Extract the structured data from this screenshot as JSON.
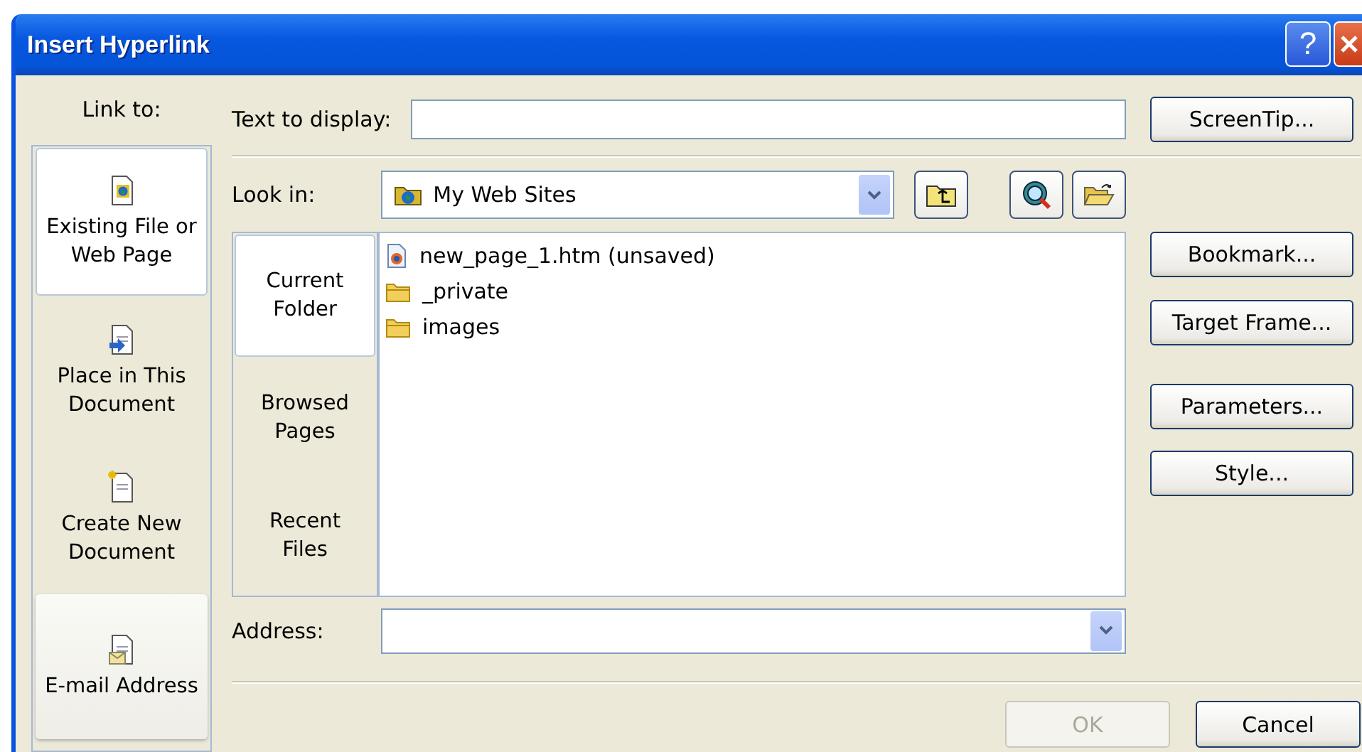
{
  "window": {
    "title": "Insert Hyperlink",
    "help_button": "?"
  },
  "link_to": {
    "label": "Link to:",
    "items": [
      {
        "label": "Existing File or Web Page",
        "kind": "globe-page",
        "selected": true,
        "highlighted": false
      },
      {
        "label": "Place in This Document",
        "kind": "arrow-page",
        "selected": false,
        "highlighted": false
      },
      {
        "label": "Create New Document",
        "kind": "new-page",
        "selected": false,
        "highlighted": false
      },
      {
        "label": "E-mail Address",
        "kind": "mail-page",
        "selected": false,
        "highlighted": true
      }
    ]
  },
  "text_to_display": {
    "label": "Text to display:"
  },
  "screentip_button": "ScreenTip...",
  "look_in": {
    "label": "Look in:",
    "value": "My Web Sites"
  },
  "places": [
    {
      "label": "Current Folder",
      "selected": true
    },
    {
      "label": "Browsed Pages",
      "selected": false
    },
    {
      "label": "Recent Files",
      "selected": false
    }
  ],
  "files": [
    {
      "name": "new_page_1.htm (unsaved)",
      "kind": "page"
    },
    {
      "name": "_private",
      "kind": "folder"
    },
    {
      "name": "images",
      "kind": "folder"
    }
  ],
  "side_buttons": [
    "Bookmark...",
    "Target Frame...",
    "Parameters...",
    "Style..."
  ],
  "address": {
    "label": "Address:"
  },
  "buttons": [
    {
      "label": "OK",
      "disabled": true
    },
    {
      "label": "Cancel",
      "disabled": false
    }
  ]
}
